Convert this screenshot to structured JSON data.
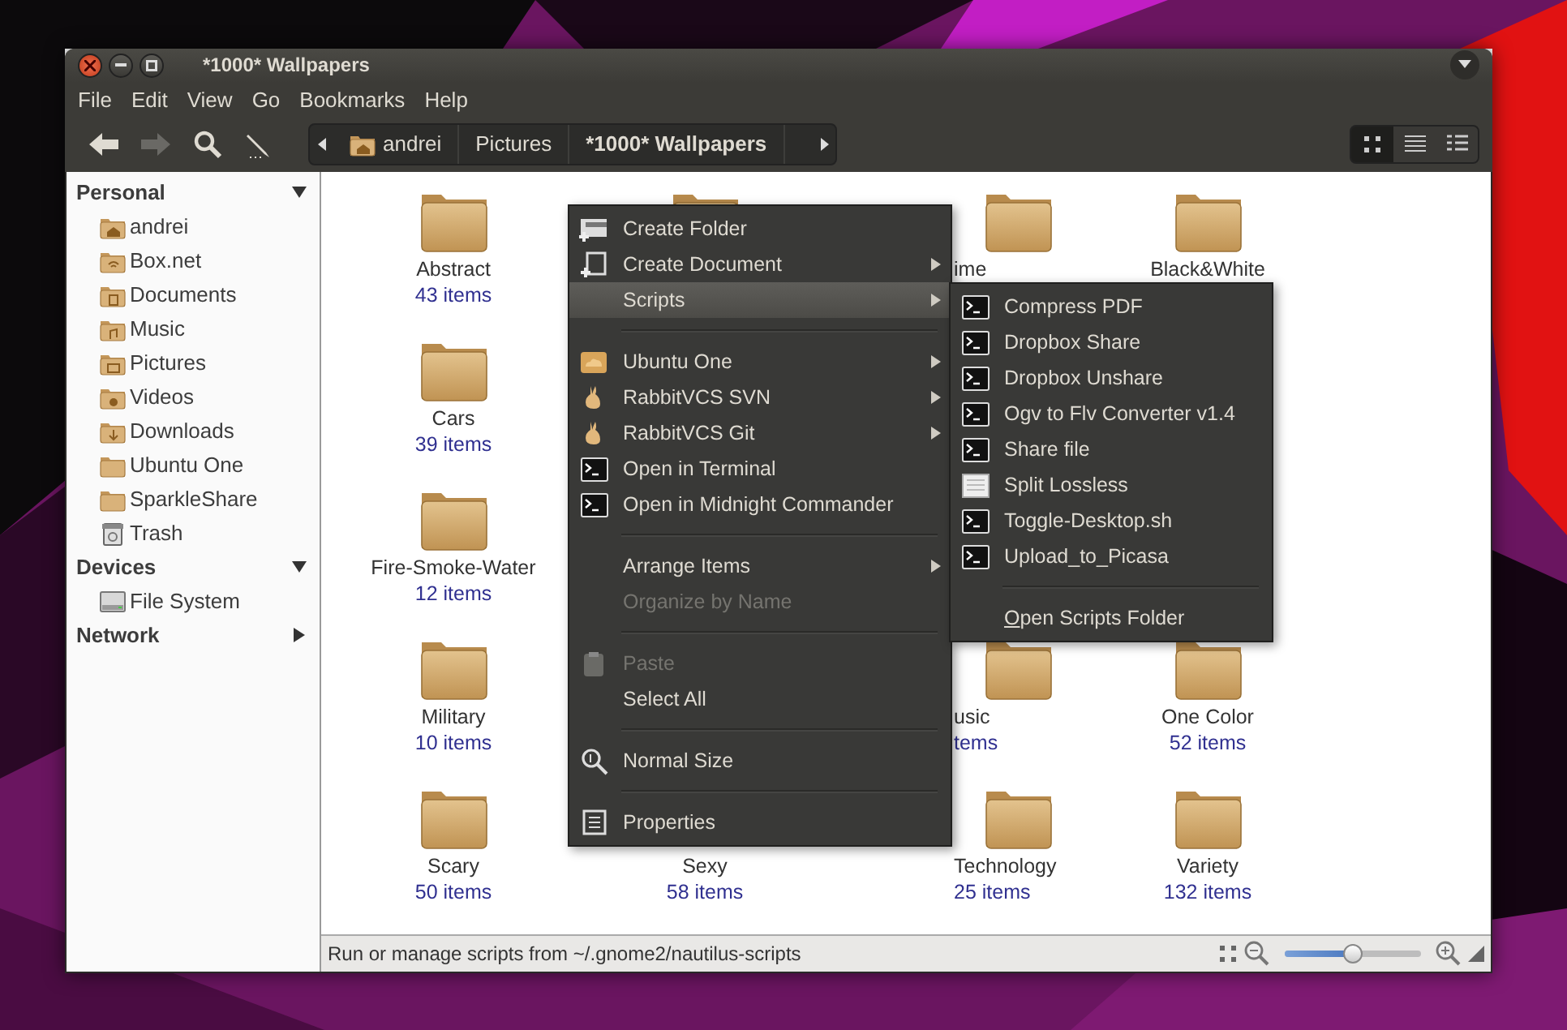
{
  "window": {
    "title": "*1000* Wallpapers"
  },
  "menu_bar": [
    "File",
    "Edit",
    "View",
    "Go",
    "Bookmarks",
    "Help"
  ],
  "toolbar": {
    "buttons": [
      {
        "kind": "back",
        "disabled": false
      },
      {
        "kind": "forward",
        "disabled": true
      },
      {
        "kind": "search",
        "disabled": false
      },
      {
        "kind": "edit",
        "disabled": false
      }
    ],
    "breadcrumbs": [
      {
        "label": "andrei",
        "kind": "home",
        "selected": false
      },
      {
        "label": "Pictures",
        "kind": "plain",
        "selected": false
      },
      {
        "label": "*1000* Wallpapers",
        "kind": "plain",
        "selected": true
      }
    ],
    "views": [
      {
        "kind": "icons",
        "selected": true
      },
      {
        "kind": "list",
        "selected": false
      },
      {
        "kind": "compact",
        "selected": false
      }
    ]
  },
  "sidebar": {
    "sections": [
      {
        "title": "Personal",
        "expanded": true,
        "items": [
          {
            "label": "andrei",
            "kind": "home"
          },
          {
            "label": "Box.net",
            "kind": "wifi"
          },
          {
            "label": "Documents",
            "kind": "document"
          },
          {
            "label": "Music",
            "kind": "music"
          },
          {
            "label": "Pictures",
            "kind": "picture"
          },
          {
            "label": "Videos",
            "kind": "video"
          },
          {
            "label": "Downloads",
            "kind": "download"
          },
          {
            "label": "Ubuntu One",
            "kind": "folder"
          },
          {
            "label": "SparkleShare",
            "kind": "folder"
          },
          {
            "label": "Trash",
            "kind": "trash"
          }
        ]
      },
      {
        "title": "Devices",
        "expanded": true,
        "items": [
          {
            "label": "File System",
            "kind": "drive"
          }
        ]
      },
      {
        "title": "Network",
        "expanded": false
      }
    ]
  },
  "folders": [
    {
      "kind": "folder",
      "name": "Abstract",
      "count": "43 items"
    },
    {
      "kind": "folder"
    },
    {
      "kind": "folder",
      "name": "ime"
    },
    {
      "kind": "folder",
      "name": "Black&White"
    },
    {
      "kind": "folder",
      "name": "Cars",
      "count": "39 items"
    },
    {
      "kind": "covered"
    },
    {
      "kind": "covered"
    },
    {
      "kind": "covered"
    },
    {
      "kind": "folder",
      "name": "Fire-Smoke-Water",
      "count": "12 items"
    },
    {
      "kind": "covered"
    },
    {
      "kind": "covered"
    },
    {
      "kind": "covered"
    },
    {
      "kind": "folder",
      "name": "Military",
      "count": "10 items"
    },
    {
      "kind": "covered"
    },
    {
      "kind": "folder",
      "name": "usic",
      "count": "tems"
    },
    {
      "kind": "folder",
      "name": "One Color",
      "count": "52 items"
    },
    {
      "kind": "folder",
      "name": "Scary",
      "count": "50 items"
    },
    {
      "kind": "covered",
      "name": "Sexy",
      "count": "58 items"
    },
    {
      "kind": "folder",
      "name": "Technology",
      "count": "25 items"
    },
    {
      "kind": "folder",
      "name": "Variety",
      "count": "132 items"
    }
  ],
  "context_menu": {
    "items": [
      {
        "kind": "newfolder",
        "label": "Create Folder",
        "submenu": false,
        "selected": false,
        "disabled": false
      },
      {
        "kind": "newdoc",
        "label": "Create Document",
        "submenu": true,
        "selected": false,
        "disabled": false
      },
      {
        "kind": "plain",
        "label": "Scripts",
        "submenu": true,
        "selected": true,
        "disabled": false
      },
      {
        "kind": "separator"
      },
      {
        "kind": "cloud",
        "label": "Ubuntu One",
        "submenu": true,
        "selected": false,
        "disabled": false
      },
      {
        "kind": "rabbit",
        "label": "RabbitVCS SVN",
        "submenu": true,
        "selected": false,
        "disabled": false
      },
      {
        "kind": "rabbit",
        "label": "RabbitVCS Git",
        "submenu": true,
        "selected": false,
        "disabled": false
      },
      {
        "kind": "terminal",
        "label": "Open in Terminal",
        "submenu": false,
        "selected": false,
        "disabled": false
      },
      {
        "kind": "terminal",
        "label": "Open in Midnight Commander",
        "submenu": false,
        "selected": false,
        "disabled": false
      },
      {
        "kind": "separator"
      },
      {
        "kind": "plain",
        "label": "Arrange Items",
        "submenu": true,
        "selected": false,
        "disabled": false
      },
      {
        "kind": "plain",
        "label": "Organize by Name",
        "submenu": false,
        "selected": false,
        "disabled": true
      },
      {
        "kind": "separator"
      },
      {
        "kind": "paste",
        "label": "Paste",
        "submenu": false,
        "selected": false,
        "disabled": true
      },
      {
        "kind": "plain",
        "label": "Select All",
        "submenu": false,
        "selected": false,
        "disabled": false
      },
      {
        "kind": "separator"
      },
      {
        "kind": "zoom",
        "label": "Normal Size",
        "submenu": false,
        "selected": false,
        "disabled": false
      },
      {
        "kind": "separator"
      },
      {
        "kind": "props",
        "label": "Properties",
        "submenu": false,
        "selected": false,
        "disabled": false
      }
    ]
  },
  "scripts_submenu": {
    "items": [
      {
        "kind": "terminal",
        "label": "Compress PDF"
      },
      {
        "kind": "terminal",
        "label": "Dropbox Share"
      },
      {
        "kind": "terminal",
        "label": "Dropbox Unshare"
      },
      {
        "kind": "terminal",
        "label": "Ogv to Flv Converter v1.4"
      },
      {
        "kind": "terminal",
        "label": "Share file"
      },
      {
        "kind": "textfile",
        "label": "Split Lossless"
      },
      {
        "kind": "terminal",
        "label": "Toggle-Desktop.sh"
      },
      {
        "kind": "terminal",
        "label": "Upload_to_Picasa"
      },
      {
        "kind": "separator"
      },
      {
        "kind": "mnemonic",
        "label": "Open Scripts Folder"
      }
    ]
  },
  "status_bar": {
    "text": "Run or manage scripts from ~/.gnome2/nautilus-scripts",
    "zoom": {
      "level": 0.5
    }
  }
}
